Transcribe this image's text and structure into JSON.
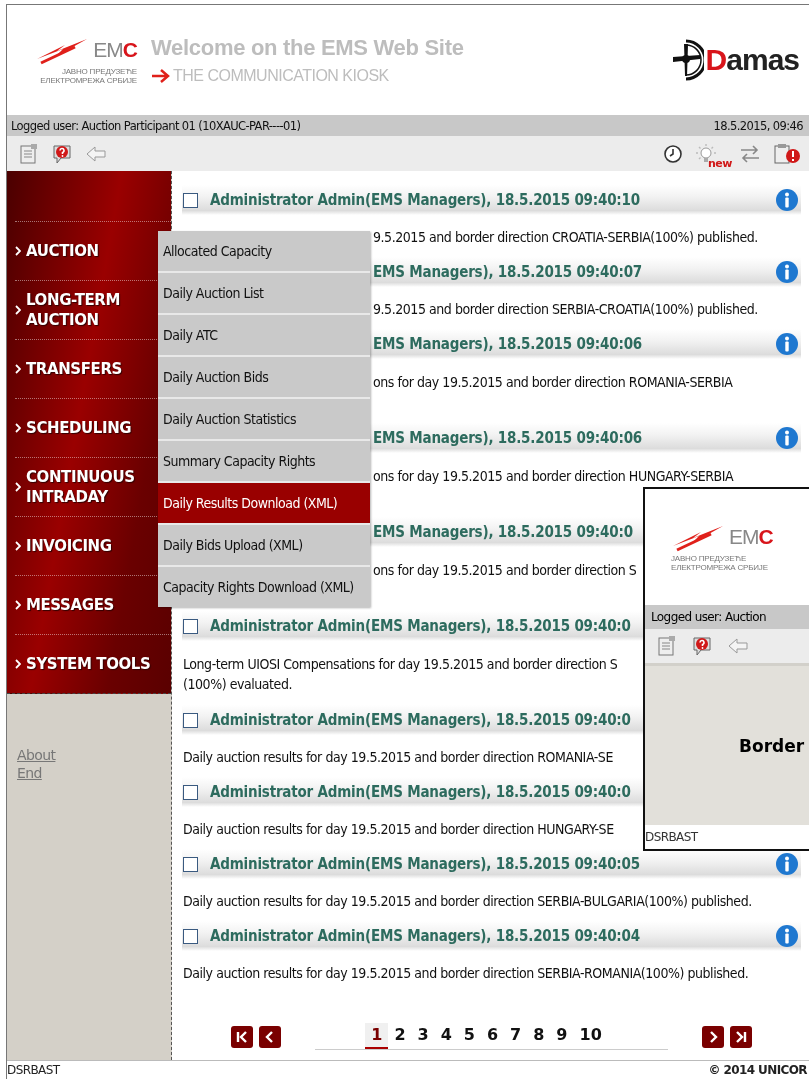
{
  "header": {
    "logo": "EMC",
    "logo_subtitle": [
      "ЈАВНО ПРЕДУЗЕЋЕ",
      "ЕЛЕКТРОМРЕЖА СРБИЈЕ"
    ],
    "title": "Welcome on the EMS Web Site",
    "subtitle": "THE COMMUNICATION KIOSK",
    "brand": "Damas"
  },
  "status_bar": {
    "user": "Logged user: Auction Participant 01 (10XAUC-PAR----01)",
    "datetime": "18.5.2015, 09:46"
  },
  "toolbar": {
    "new_badge": "new"
  },
  "sidebar": {
    "items": [
      "AUCTION",
      "LONG-TERM AUCTION",
      "TRANSFERS",
      "SCHEDULING",
      "CONTINUOUS INTRADAY",
      "INVOICING",
      "MESSAGES",
      "SYSTEM TOOLS"
    ],
    "links": [
      "About",
      "End"
    ]
  },
  "menu": {
    "items": [
      {
        "label": "Allocated Capacity",
        "selected": false
      },
      {
        "label": "Daily Auction List",
        "selected": false
      },
      {
        "label": "Daily ATC",
        "selected": false
      },
      {
        "label": "Daily Auction Bids",
        "selected": false
      },
      {
        "label": "Daily Auction Statistics",
        "selected": false
      },
      {
        "label": "Summary Capacity Rights",
        "selected": false
      },
      {
        "label": "Daily Results Download (XML)",
        "selected": true
      },
      {
        "label": "Daily Bids Upload (XML)",
        "selected": false
      },
      {
        "label": "Capacity Rights Download (XML)",
        "selected": false
      }
    ]
  },
  "messages": [
    {
      "checked": false,
      "header": "Administrator Admin(EMS Managers), 18.5.2015 09:40:10",
      "body": [
        "9.5.2015 and border direction CROATIA-SERBIA(100%) published."
      ],
      "wrapped": false
    },
    {
      "header": "EMS Managers), 18.5.2015 09:40:07",
      "body": [
        "9.5.2015 and border direction SERBIA-CROATIA(100%) published."
      ],
      "wrapped": false
    },
    {
      "header": "EMS Managers), 18.5.2015 09:40:06",
      "body": [
        "ons for day 19.5.2015 and border direction ROMANIA-SERBIA"
      ],
      "wrapped": true
    },
    {
      "header": "EMS Managers), 18.5.2015 09:40:06",
      "body": [
        "ons for day 19.5.2015 and border direction HUNGARY-SERBIA"
      ],
      "wrapped": true
    },
    {
      "header": "EMS Managers), 18.5.2015 09:40:0",
      "body": [
        "ons for day 19.5.2015 and border direction S"
      ],
      "wrapped": true
    },
    {
      "checked": false,
      "header": "Administrator Admin(EMS Managers), 18.5.2015 09:40:0",
      "body": [
        "Long-term UIOSI Compensations for day 19.5.2015 and border direction S",
        "(100%) evaluated."
      ]
    },
    {
      "checked": false,
      "header": "Administrator Admin(EMS Managers), 18.5.2015 09:40:0",
      "body": [
        "Daily auction results for day 19.5.2015 and border direction ROMANIA-SE"
      ],
      "wrapped": false
    },
    {
      "checked": false,
      "header": "Administrator Admin(EMS Managers), 18.5.2015 09:40:0",
      "body": [
        "Daily auction results for day 19.5.2015 and border direction HUNGARY-SE"
      ],
      "wrapped": false
    },
    {
      "checked": false,
      "header": "Administrator Admin(EMS Managers), 18.5.2015 09:40:05",
      "body": [
        "Daily auction results for day 19.5.2015 and border direction SERBIA-BULGARIA(100%) published."
      ],
      "wrapped": false
    },
    {
      "checked": false,
      "header": "Administrator Admin(EMS Managers), 18.5.2015 09:40:04",
      "body": [
        "Daily auction results for day 19.5.2015 and border direction SERBIA-ROMANIA(100%) published."
      ],
      "wrapped": false
    }
  ],
  "pagination": {
    "pages": [
      {
        "label": "1",
        "selected": true
      },
      {
        "label": "2",
        "selected": false
      },
      {
        "label": "3",
        "selected": false
      },
      {
        "label": "4",
        "selected": false
      },
      {
        "label": "5",
        "selected": false
      },
      {
        "label": "6",
        "selected": false
      },
      {
        "label": "7",
        "selected": false
      },
      {
        "label": "8",
        "selected": false
      },
      {
        "label": "9",
        "selected": false
      },
      {
        "label": "10",
        "selected": false
      }
    ]
  },
  "popup": {
    "logo": "EMC",
    "logo_subtitle": [
      "ЈАВНО ПРЕДУЗЕЋЕ",
      "ЕЛЕКТРОМРЕЖА СРБИЈЕ"
    ],
    "user": "Logged user: Auction",
    "heading": "Border",
    "footer": "DSRBAST"
  },
  "footer": {
    "left": "DSRBAST",
    "right": "© 2014 UNICOR"
  }
}
